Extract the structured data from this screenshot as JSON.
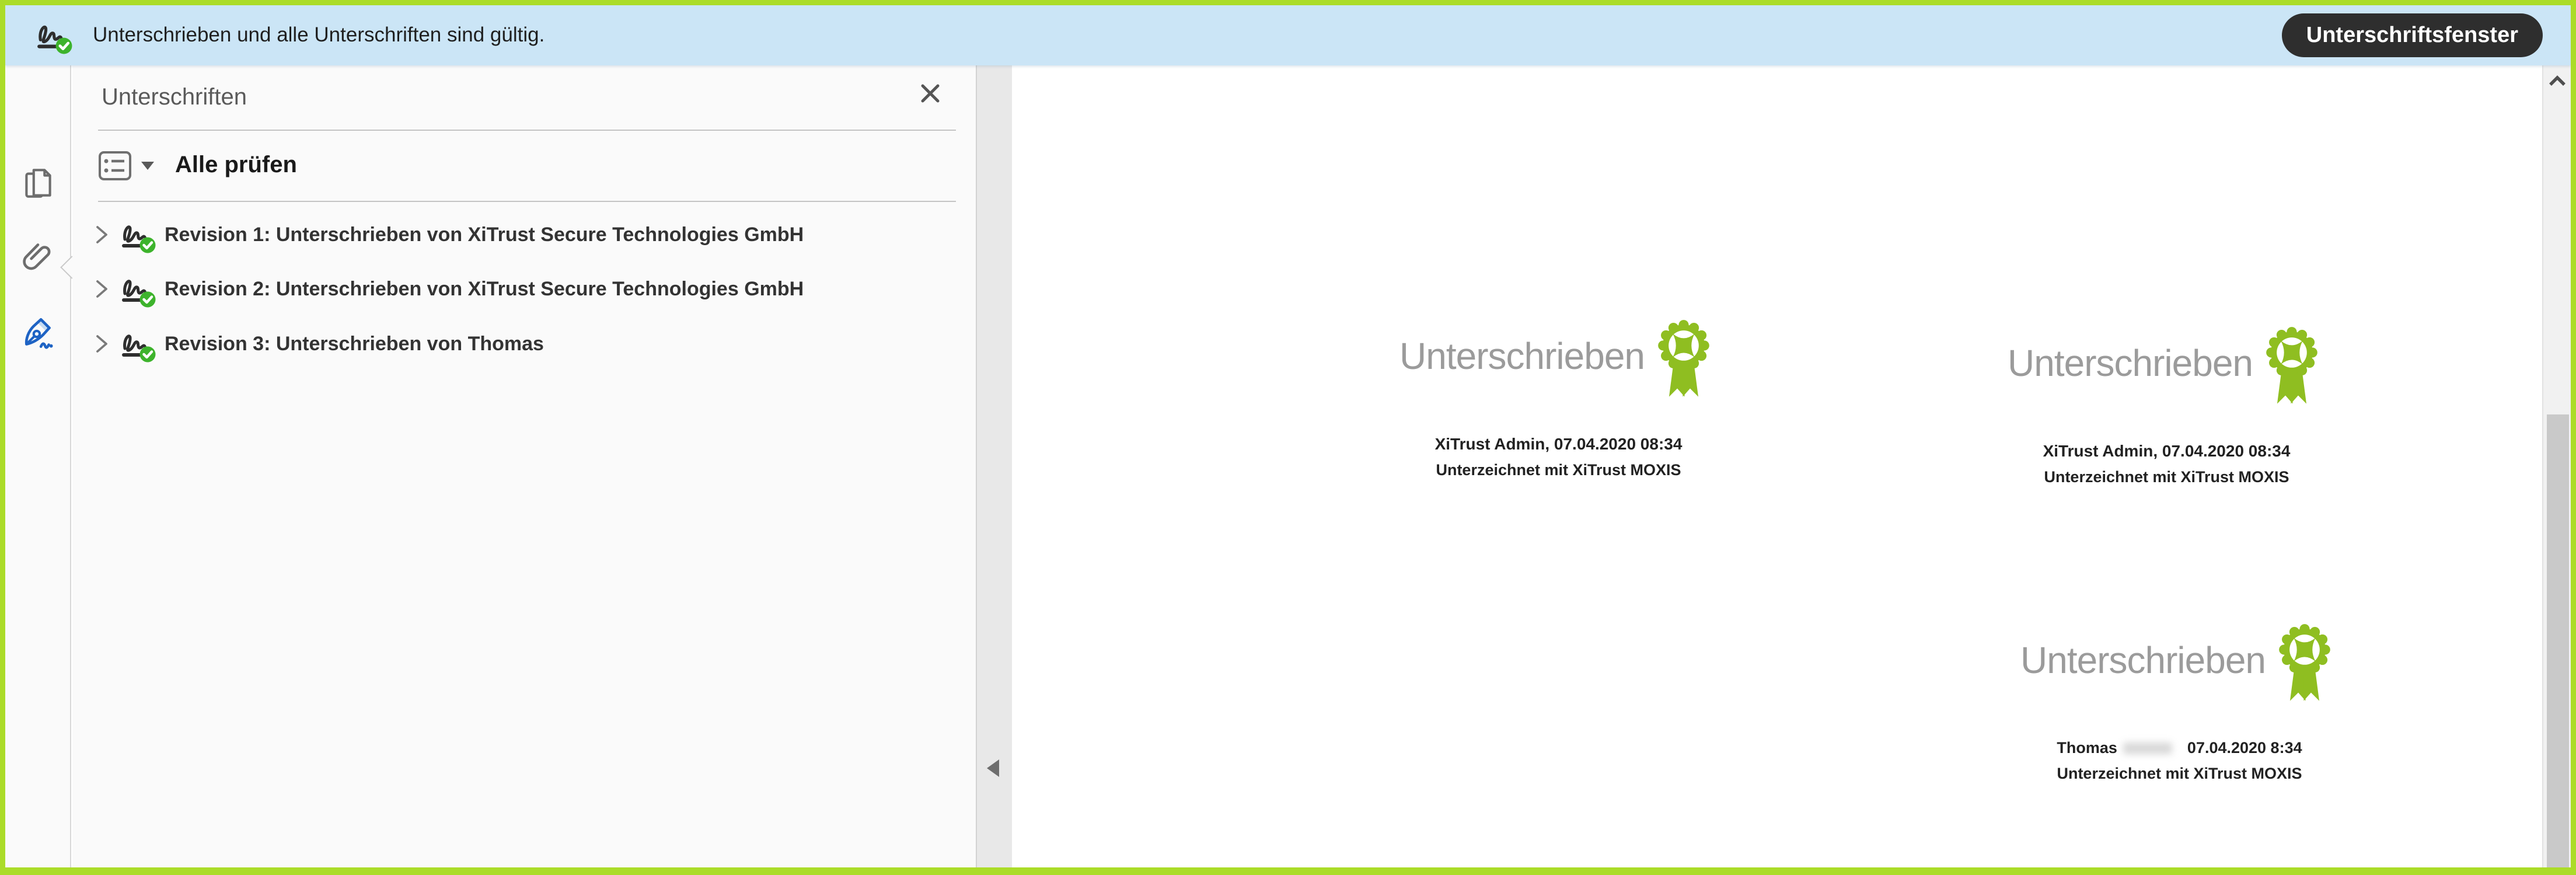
{
  "banner": {
    "status_text": "Unterschrieben und alle Unterschriften sind gültig.",
    "button_label": "Unterschriftsfenster"
  },
  "panel": {
    "title": "Unterschriften",
    "validate_all_label": "Alle prüfen",
    "revisions": [
      {
        "label": "Revision 1: Unterschrieben von XiTrust Secure Technologies GmbH"
      },
      {
        "label": "Revision 2: Unterschrieben von XiTrust Secure Technologies GmbH"
      },
      {
        "label": "Revision 3: Unterschrieben von Thomas"
      }
    ]
  },
  "document": {
    "stamps": [
      {
        "word": "Unterschrieben",
        "line1": "XiTrust Admin, 07.04.2020 08:34",
        "line2": "Unterzeichnet mit XiTrust MOXIS"
      },
      {
        "word": "Unterschrieben",
        "line1": "XiTrust Admin, 07.04.2020 08:34",
        "line2": "Unterzeichnet mit XiTrust MOXIS"
      },
      {
        "word": "Unterschrieben",
        "name": "Thomas",
        "date": "07.04.2020  8:34",
        "line2": "Unterzeichnet mit XiTrust MOXIS"
      }
    ]
  },
  "icons": {
    "banner_status": "signature-valid-icon",
    "sidebar": [
      "page-thumbnails-icon",
      "paperclip-attachments-icon",
      "signature-pen-icon"
    ],
    "panel": [
      "options-list-icon",
      "caret-down-icon",
      "close-icon",
      "chevron-right-icon",
      "signature-valid-icon"
    ],
    "document": "xitrust-rosette-badge-icon",
    "scrollbar": [
      "chevron-up-icon"
    ],
    "splitter": "collapse-left-arrow-icon"
  },
  "colors": {
    "frame_green": "#abdc28",
    "banner_blue": "#cbe5f6",
    "button_dark": "#2e2e2e",
    "badge_green": "#8fbe21",
    "check_green": "#3db32c",
    "active_icon_blue": "#1e63c4",
    "panel_bg": "#fafafa"
  }
}
